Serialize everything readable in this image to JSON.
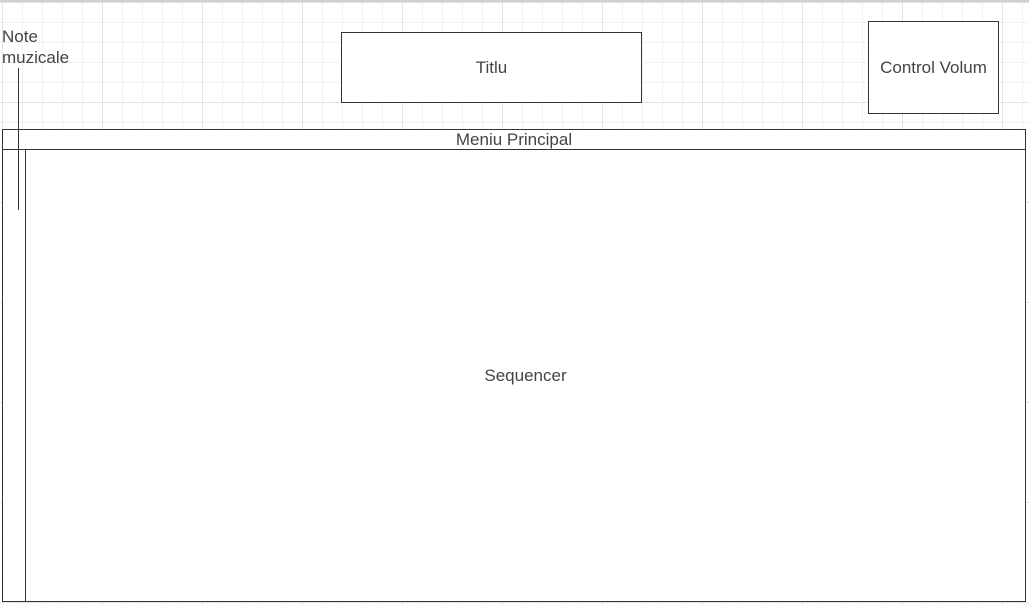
{
  "diagram": {
    "title_box": "Titlu",
    "volume_box": "Control Volum",
    "menu_bar": "Meniu Principal",
    "sequencer": "Sequencer",
    "notes_label": "Note\nmuzicale"
  },
  "colors": {
    "stroke": "#333333",
    "text": "#444444",
    "grid": "#e2e2e2",
    "background": "#ffffff"
  }
}
